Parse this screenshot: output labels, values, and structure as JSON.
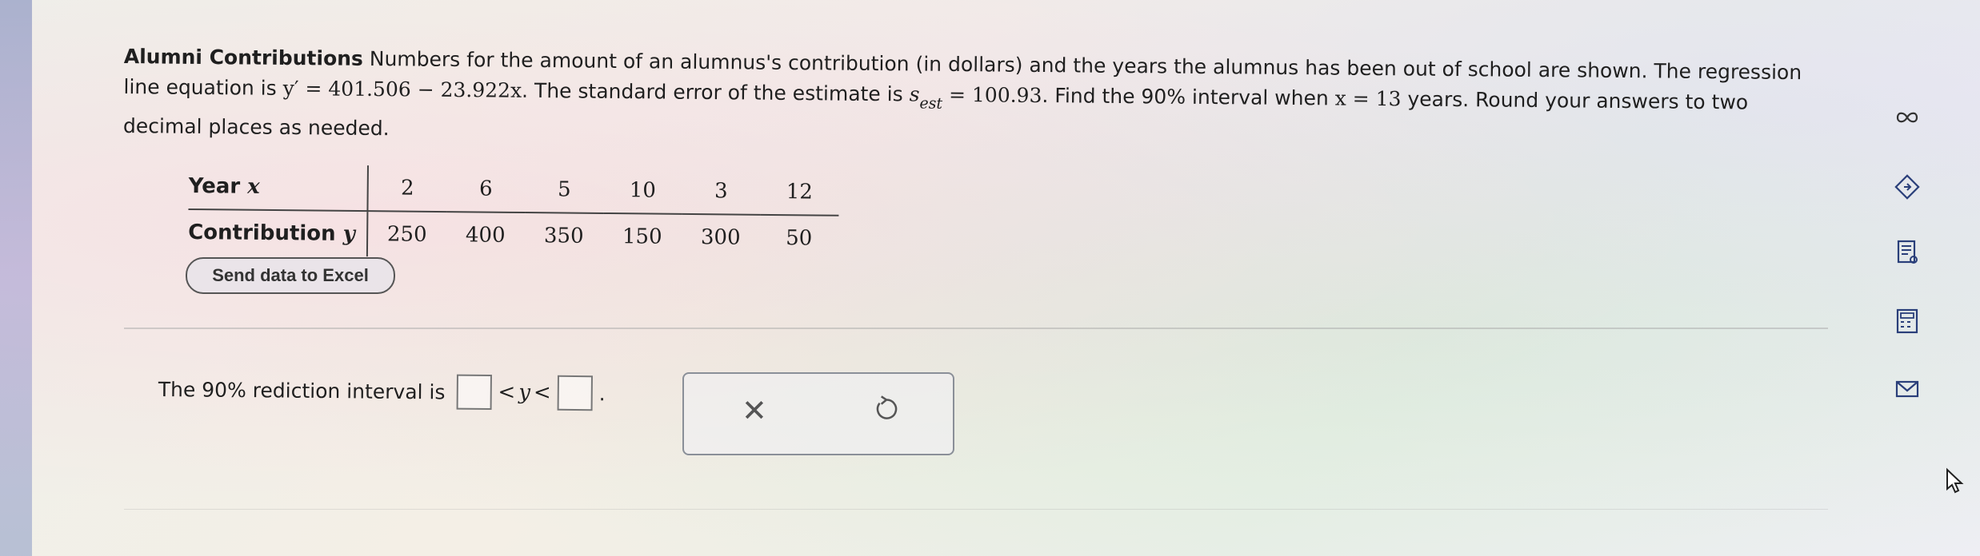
{
  "question": {
    "title": "Alumni Contributions",
    "text_1": "Numbers for the amount of an alumnus's contribution (in dollars) and the years the alumnus has been out of school are shown. The regression line equation is",
    "equation": "y′ = 401.506 − 23.922x",
    "text_2": ". The standard error of the estimate is",
    "s_symbol": "s",
    "s_sub": "est",
    "s_value": "= 100.93",
    "text_3": ". Find the 90% interval when",
    "x_value": "x = 13",
    "text_4": "years. Round your answers to two decimal places as needed."
  },
  "table": {
    "row1_label": "Year",
    "row1_var": "x",
    "row2_label": "Contribution",
    "row2_var": "y",
    "years": [
      "2",
      "6",
      "5",
      "10",
      "3",
      "12"
    ],
    "contributions": [
      "250",
      "400",
      "350",
      "150",
      "300",
      "50"
    ]
  },
  "excel_button": "Send data to Excel",
  "answer": {
    "prompt": "The 90% rediction interval is",
    "lt1": "<",
    "var": "y",
    "lt2": "<",
    "period": "."
  },
  "icons": {
    "infinity": "infinity-icon",
    "hint": "diamond-hint-icon",
    "notes": "worksheet-icon",
    "calculator": "calculator-icon",
    "mail": "mail-icon",
    "cursor": "pointer-cursor-icon"
  }
}
